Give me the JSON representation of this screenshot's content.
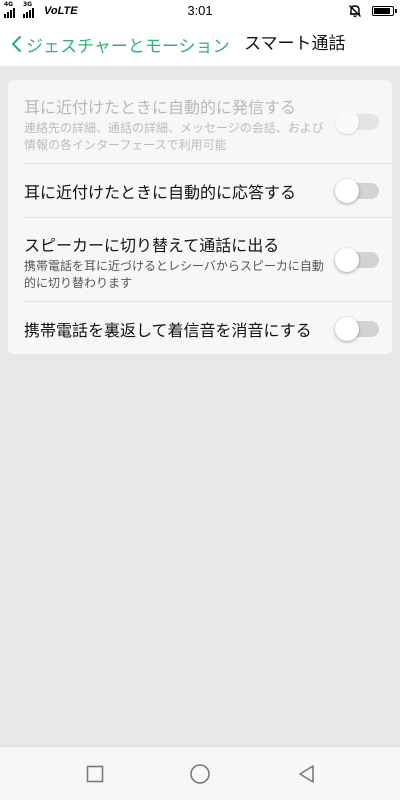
{
  "status_bar": {
    "network_tags": [
      "4G",
      "3G"
    ],
    "carrier_label": "VoLTE",
    "time": "3:01",
    "icons": [
      "signal-icon",
      "mute-icon",
      "battery-icon"
    ],
    "battery_level": 0.95
  },
  "header": {
    "back_label": "ジェスチャーとモーション",
    "title": "スマート通話",
    "accent_color": "#2eb46f"
  },
  "settings": {
    "items": [
      {
        "title": "耳に近付けたときに自動的に発信する",
        "description": "連絡先の詳細、通話の詳細、メッセージの会話、および情報の各インターフェースで利用可能",
        "enabled": false,
        "on": false
      },
      {
        "title": "耳に近付けたときに自動的に応答する",
        "description": "",
        "enabled": true,
        "on": false
      },
      {
        "title": "スピーカーに切り替えて通話に出る",
        "description": "携帯電話を耳に近づけるとレシーバからスピーカに自動的に切り替わります",
        "enabled": true,
        "on": false
      },
      {
        "title": "携帯電話を裏返して着信音を消音にする",
        "description": "",
        "enabled": true,
        "on": false
      }
    ]
  },
  "nav_bar": {
    "icons": [
      "recent-apps-icon",
      "home-icon",
      "back-icon"
    ]
  }
}
